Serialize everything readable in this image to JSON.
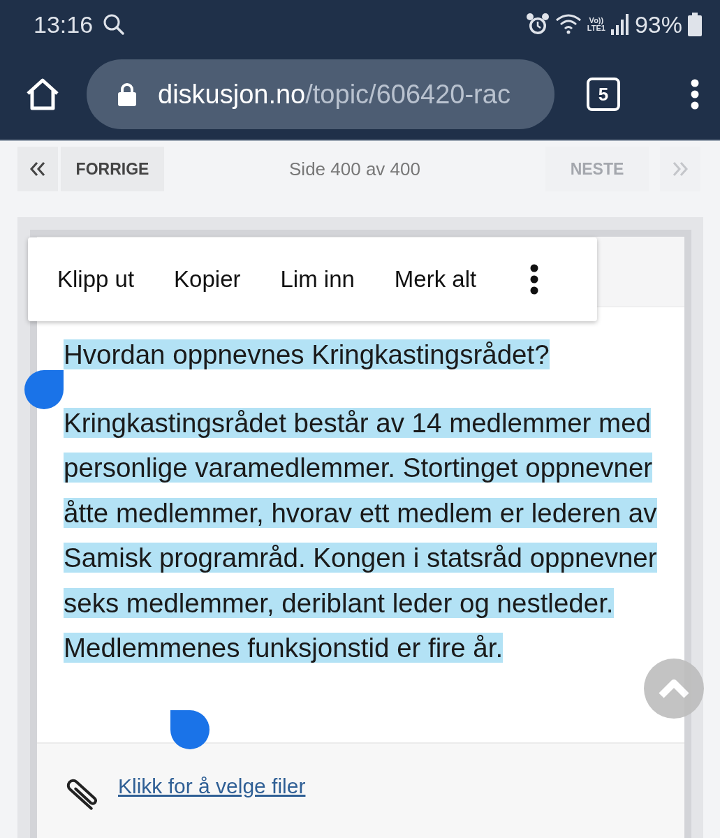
{
  "status_bar": {
    "time": "13:16",
    "network": "Vo))\nLTE1",
    "battery": "93%"
  },
  "browser": {
    "url_host": "diskusjon.no",
    "url_path": "/topic/606420-rac",
    "tab_count": "5"
  },
  "pager": {
    "prev_label": "FORRIGE",
    "prev_disabled": false,
    "page_info": "Side 400 av 400",
    "next_label": "NESTE",
    "next_disabled": true
  },
  "context_menu": [
    "Klipp ut",
    "Kopier",
    "Lim inn",
    "Merk alt"
  ],
  "editor": {
    "paragraphs": [
      {
        "text": "Hvordan oppnevnes Kringkastingsrådet?",
        "selected": true
      },
      {
        "text": "Kringkastingsrådet består av 14 medlemmer med personlige varamedlemmer. Stortinget oppnevner åtte medlemmer, hvorav ett medlem er lederen av Samisk programråd. Kongen i statsråd oppnevner seks medlemmer, deriblant leder og nestleder. Medlemmenes funksjonstid er fire år.",
        "selected": true
      }
    ]
  },
  "attach_link": "Klikk for å velge filer"
}
